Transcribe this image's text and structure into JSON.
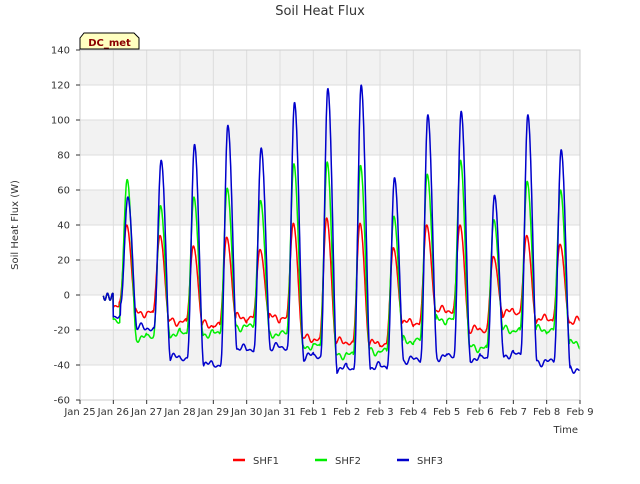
{
  "chart_data": {
    "type": "line",
    "title": "Soil Heat Flux",
    "xlabel": "Time",
    "ylabel": "Soil Heat Flux (W)",
    "ylim": [
      -60,
      140
    ],
    "yticks": [
      -60,
      -40,
      -20,
      0,
      20,
      40,
      60,
      80,
      100,
      120,
      140
    ],
    "xlim": [
      0,
      15
    ],
    "xticks": [
      0,
      1,
      2,
      3,
      4,
      5,
      6,
      7,
      8,
      9,
      10,
      11,
      12,
      13,
      14,
      15
    ],
    "xtick_labels": [
      "Jan 25",
      "Jan 26",
      "Jan 27",
      "Jan 28",
      "Jan 29",
      "Jan 30",
      "Jan 31",
      "Feb 1",
      "Feb 2",
      "Feb 3",
      "Feb 4",
      "Feb 5",
      "Feb 6",
      "Feb 7",
      "Feb 8",
      "Feb 9"
    ],
    "grid": true,
    "legend_position": "bottom",
    "annotation": "DC_met",
    "daily": {
      "days": [
        "Jan 26",
        "Jan 27",
        "Jan 28",
        "Jan 29",
        "Jan 30",
        "Jan 31",
        "Feb 1",
        "Feb 2",
        "Feb 3",
        "Feb 4",
        "Feb 5",
        "Feb 6",
        "Feb 7",
        "Feb 8"
      ]
    },
    "series": [
      {
        "name": "SHF1",
        "color": "#ff0000",
        "peaks": [
          40,
          34,
          28,
          33,
          26,
          41,
          44,
          41,
          27,
          40,
          40,
          22,
          34,
          29
        ],
        "mins": [
          -10,
          -15,
          -17,
          -13,
          -13,
          -25,
          -27,
          -28,
          -16,
          -9,
          -20,
          -10,
          -14,
          -15
        ]
      },
      {
        "name": "SHF2",
        "color": "#00ee00",
        "peaks": [
          66,
          51,
          56,
          61,
          54,
          75,
          76,
          74,
          45,
          69,
          77,
          43,
          65,
          60
        ],
        "mins": [
          -24,
          -22,
          -22,
          -18,
          -22,
          -29,
          -34,
          -32,
          -26,
          -14,
          -30,
          -20,
          -20,
          -28
        ]
      },
      {
        "name": "SHF3",
        "color": "#0000cc",
        "peaks": [
          56,
          77,
          86,
          97,
          84,
          110,
          118,
          120,
          67,
          103,
          105,
          57,
          103,
          83
        ],
        "mins": [
          -19,
          -36,
          -40,
          -31,
          -30,
          -35,
          -42,
          -41,
          -37,
          -35,
          -36,
          -34,
          -38,
          -42
        ]
      }
    ]
  },
  "legend": {
    "items": [
      {
        "label": "SHF1",
        "color": "#ff0000"
      },
      {
        "label": "SHF2",
        "color": "#00ee00"
      },
      {
        "label": "SHF3",
        "color": "#0000cc"
      }
    ]
  }
}
